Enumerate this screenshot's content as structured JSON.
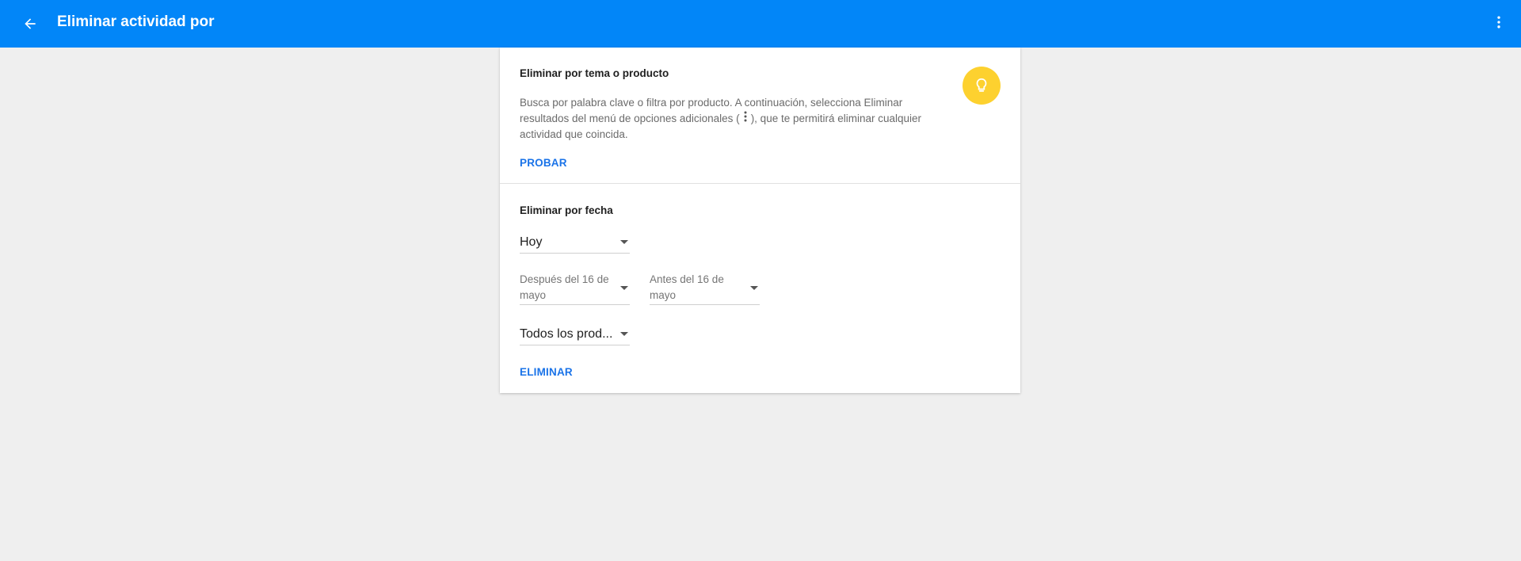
{
  "app_bar": {
    "title": "Eliminar actividad por",
    "back_icon": "arrow-back-icon",
    "more_icon": "more-vert-icon",
    "color": "#0286f8"
  },
  "topic_section": {
    "title": "Eliminar por tema o producto",
    "body_part1": "Busca por palabra clave o filtra por producto. A continuación, selecciona Eliminar resultados del menú de opciones adicionales (",
    "body_part2": "), que te permitirá eliminar cualquier actividad que coincida.",
    "action_label": "PROBAR",
    "tip_icon": "lightbulb-icon",
    "tip_color": "#fdd12f"
  },
  "date_section": {
    "title": "Eliminar por fecha",
    "range_select": {
      "value": "Hoy"
    },
    "after_select": {
      "value": "Después del 16 de mayo"
    },
    "before_select": {
      "value": "Antes del 16 de mayo"
    },
    "product_select": {
      "value": "Todos los prod..."
    },
    "action_label": "ELIMINAR",
    "accent_color": "#1a73e8"
  }
}
